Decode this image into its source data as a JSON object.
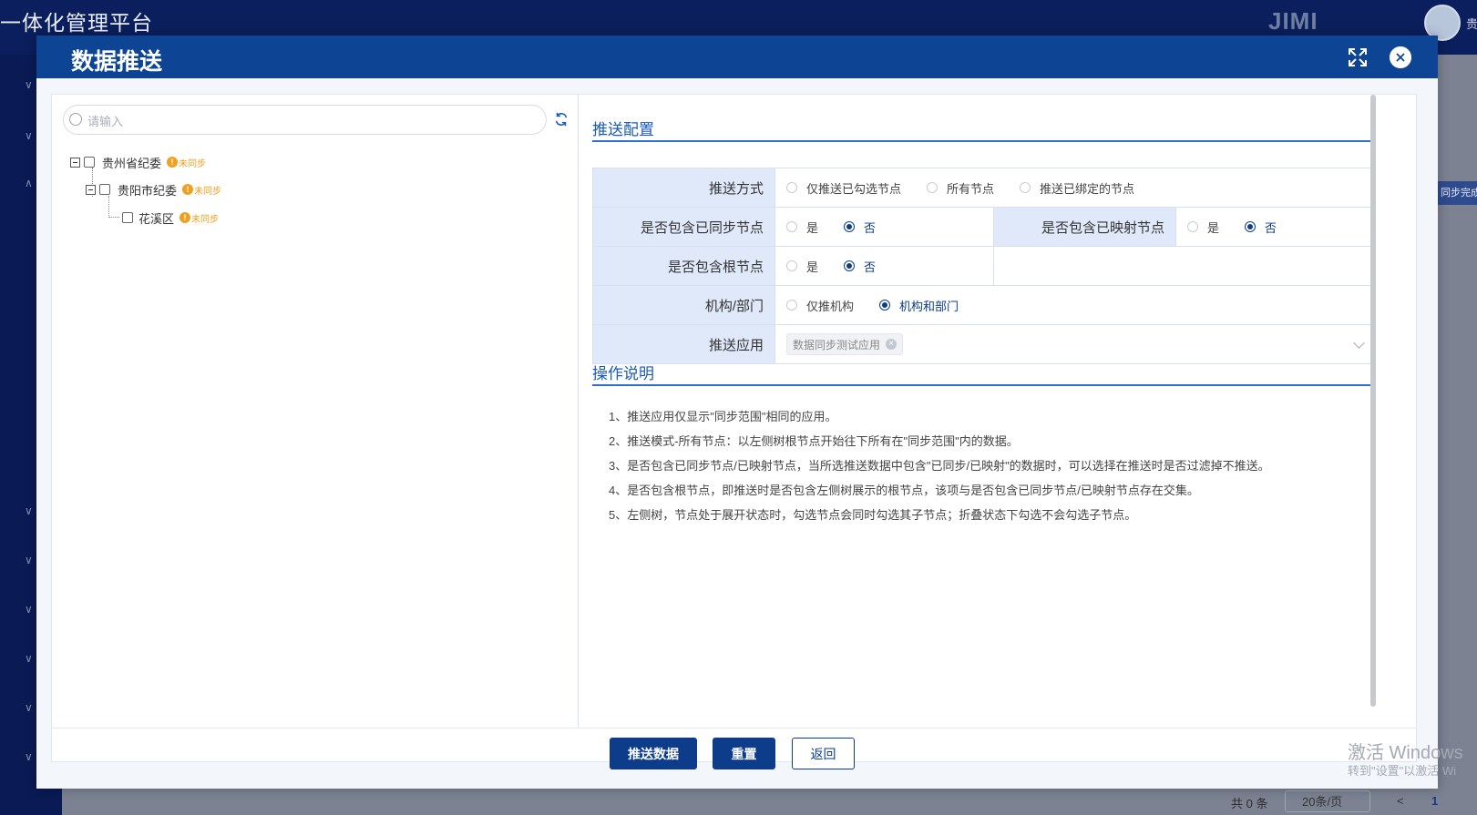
{
  "background": {
    "app_title": "一体化管理平台",
    "logo": "JIMI",
    "user": "贵",
    "chip": "同步完成",
    "total": "共 0 条",
    "page_size": "20条/页",
    "current_page": "1"
  },
  "watermark": {
    "line1": "激活 Windows",
    "line2": "转到\"设置\"以激活 Wi"
  },
  "modal": {
    "title": "数据推送"
  },
  "search": {
    "placeholder": "请输入"
  },
  "tree": {
    "nodes": [
      {
        "label": "贵州省纪委",
        "status": "未同步"
      },
      {
        "label": "贵阳市纪委",
        "status": "未同步"
      },
      {
        "label": "花溪区",
        "status": "未同步"
      }
    ]
  },
  "config": {
    "section_title": "推送配置",
    "push_mode": {
      "label": "推送方式",
      "options": [
        "仅推送已勾选节点",
        "所有节点",
        "推送已绑定的节点"
      ]
    },
    "include_synced": {
      "label": "是否包含已同步节点",
      "options": [
        "是",
        "否"
      ],
      "selected": "否"
    },
    "include_mapped": {
      "label": "是否包含已映射节点",
      "options": [
        "是",
        "否"
      ],
      "selected": "否"
    },
    "include_root": {
      "label": "是否包含根节点",
      "options": [
        "是",
        "否"
      ],
      "selected": "否"
    },
    "org_dept": {
      "label": "机构/部门",
      "options": [
        "仅推机构",
        "机构和部门"
      ],
      "selected": "机构和部门"
    },
    "push_app": {
      "label": "推送应用",
      "tag": "数据同步测试应用"
    }
  },
  "notes": {
    "section_title": "操作说明",
    "items": [
      "1、推送应用仅显示\"同步范围\"相同的应用。",
      "2、推送模式-所有节点：以左侧树根节点开始往下所有在\"同步范围\"内的数据。",
      "3、是否包含已同步节点/已映射节点，当所选推送数据中包含\"已同步/已映射\"的数据时，可以选择在推送时是否过滤掉不推送。",
      "4、是否包含根节点，即推送时是否包含左侧树展示的根节点，该项与是否包含已同步节点/已映射节点存在交集。",
      "5、左侧树，节点处于展开状态时，勾选节点会同时勾选其子节点；折叠状态下勾选不会勾选子节点。"
    ]
  },
  "buttons": {
    "push": "推送数据",
    "reset": "重置",
    "back": "返回"
  },
  "colors": {
    "primary": "#0d3d8a",
    "header": "#0d4494",
    "warning": "#f0a020",
    "link": "#1a5ab8"
  }
}
